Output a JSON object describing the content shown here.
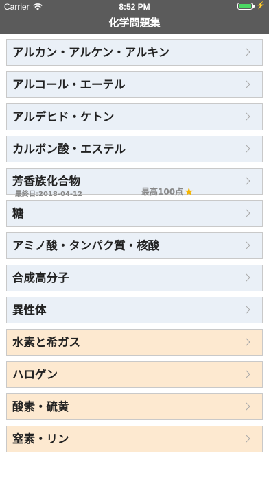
{
  "status_bar": {
    "carrier": "Carrier",
    "time": "8:52 PM",
    "wifi_icon": "wifi-icon",
    "battery_icon": "battery-full-charging-icon",
    "battery_level": 1.0
  },
  "nav": {
    "title": "化学問題集"
  },
  "colors": {
    "nav_bg": "#5b5b5b",
    "row_blue": "#eaf0f7",
    "row_orange": "#fde9d0",
    "star": "#f5b400"
  },
  "rows": [
    {
      "label": "アルカン・アルケン・アルキン",
      "theme": "blue"
    },
    {
      "label": "アルコール・エーテル",
      "theme": "blue"
    },
    {
      "label": "アルデヒド・ケトン",
      "theme": "blue"
    },
    {
      "label": "カルボン酸・エステル",
      "theme": "blue"
    },
    {
      "label": "芳香族化合物",
      "theme": "blue",
      "last_played": "最終日:2018-04-12",
      "best_score": "最高100点",
      "badge_icon": "star-icon"
    },
    {
      "label": "糖",
      "theme": "blue"
    },
    {
      "label": "アミノ酸・タンパク質・核酸",
      "theme": "blue"
    },
    {
      "label": "合成高分子",
      "theme": "blue"
    },
    {
      "label": "異性体",
      "theme": "blue"
    },
    {
      "label": "水素と希ガス",
      "theme": "orange"
    },
    {
      "label": "ハロゲン",
      "theme": "orange"
    },
    {
      "label": "酸素・硫黄",
      "theme": "orange"
    },
    {
      "label": "窒素・リン",
      "theme": "orange"
    }
  ]
}
